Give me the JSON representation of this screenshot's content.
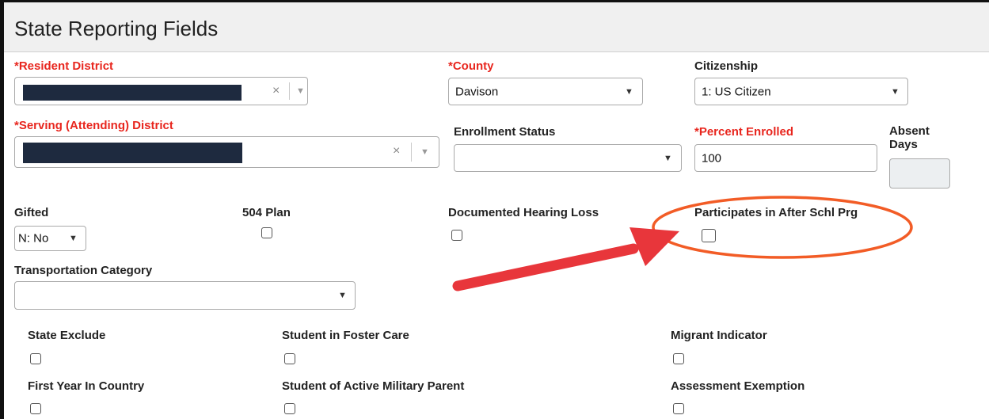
{
  "header": {
    "title": "State Reporting Fields"
  },
  "fields": {
    "resident_district": {
      "label": "*Resident District",
      "clear": "×"
    },
    "county": {
      "label": "*County",
      "value": "Davison"
    },
    "citizenship": {
      "label": "Citizenship",
      "value": "1: US Citizen"
    },
    "serving_district": {
      "label": "*Serving (Attending) District",
      "clear": "×"
    },
    "enrollment_status": {
      "label": "Enrollment Status",
      "value": ""
    },
    "percent_enrolled": {
      "label": "*Percent Enrolled",
      "value": "100"
    },
    "absent_days": {
      "label_line1": "Absent",
      "label_line2": "Days",
      "value": ""
    },
    "gifted": {
      "label": "Gifted",
      "value": "N: No"
    },
    "plan_504": {
      "label": "504 Plan"
    },
    "documented_hearing_loss": {
      "label": "Documented Hearing Loss"
    },
    "participates_after_school": {
      "label": "Participates in After Schl Prg"
    },
    "transportation_category": {
      "label": "Transportation Category",
      "value": ""
    },
    "state_exclude": {
      "label": "State Exclude"
    },
    "student_foster_care": {
      "label": "Student in Foster Care"
    },
    "migrant_indicator": {
      "label": "Migrant Indicator"
    },
    "first_year_in_country": {
      "label": "First Year In Country"
    },
    "student_military_parent": {
      "label": "Student of Active Military Parent"
    },
    "assessment_exemption": {
      "label": "Assessment Exemption"
    }
  },
  "icons": {
    "caret": "▼"
  },
  "colors": {
    "required": "#e8261e",
    "annotation": "#f25c26",
    "arrow": "#e8363b",
    "redaction": "#1e2a3f"
  }
}
